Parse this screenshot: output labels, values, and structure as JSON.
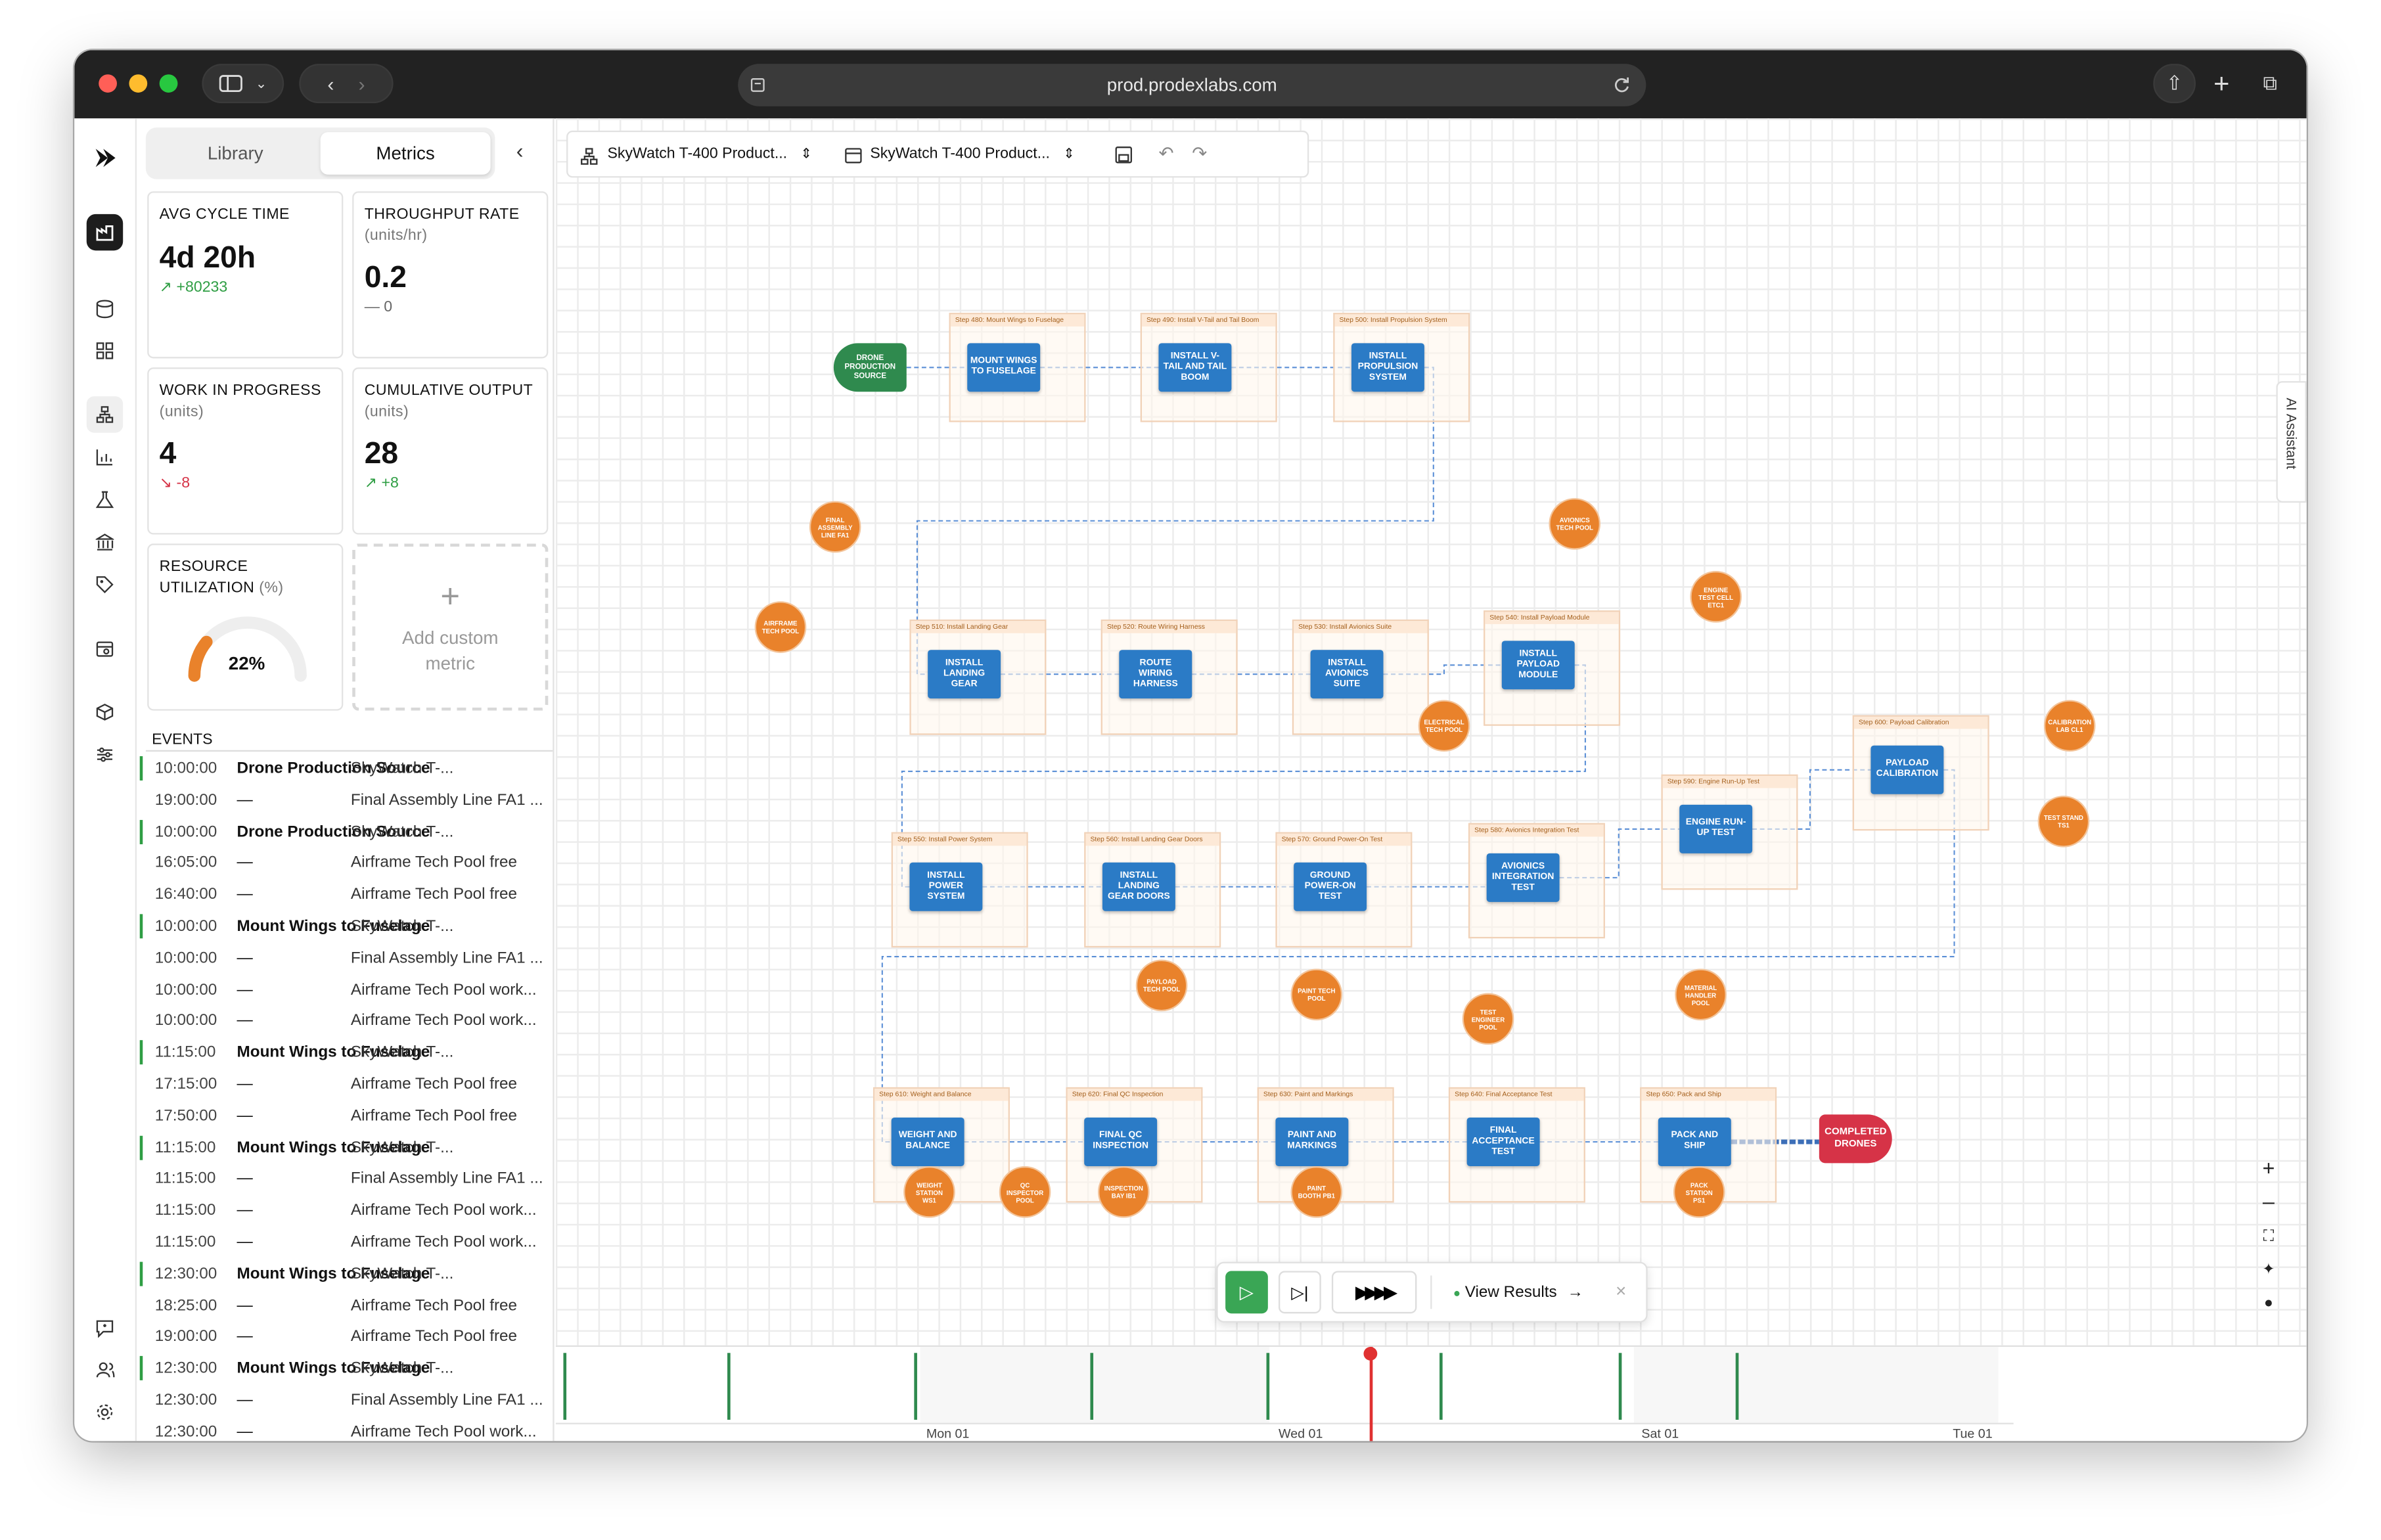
{
  "browser": {
    "url": "prod.prodexlabs.com"
  },
  "panel": {
    "tabs": [
      "Library",
      "Metrics"
    ],
    "metrics": [
      {
        "label": "AVG CYCLE TIME",
        "unit": "",
        "value": "4d 20h",
        "delta": "+80233",
        "trend": "up"
      },
      {
        "label": "THROUGHPUT RATE",
        "unit": "(units/hr)",
        "value": "0.2",
        "delta": "0",
        "trend": "flat"
      },
      {
        "label": "WORK IN PROGRESS",
        "unit": "(units)",
        "value": "4",
        "delta": "-8",
        "trend": "down"
      },
      {
        "label": "CUMULATIVE OUTPUT",
        "unit": "(units)",
        "value": "28",
        "delta": "+8",
        "trend": "up"
      }
    ],
    "utilization": {
      "label": "RESOURCE UTILIZATION",
      "unit": "(%)",
      "value": "22%",
      "fraction": 0.22
    },
    "add_metric": "Add custom metric",
    "events_title": "EVENTS",
    "events": [
      {
        "time": "10:00:00",
        "name": "Drone Production Source",
        "desc": "SkyWatch T-...",
        "bar": true
      },
      {
        "time": "19:00:00",
        "name": "—",
        "desc": "Final Assembly Line FA1 ...",
        "bar": false
      },
      {
        "time": "10:00:00",
        "name": "Drone Production Source",
        "desc": "SkyWatch T-...",
        "bar": true
      },
      {
        "time": "16:05:00",
        "name": "—",
        "desc": "Airframe Tech Pool free",
        "bar": false
      },
      {
        "time": "16:40:00",
        "name": "—",
        "desc": "Airframe Tech Pool free",
        "bar": false
      },
      {
        "time": "10:00:00",
        "name": "Mount Wings to Fuselage",
        "desc": "SkyWatch T-...",
        "bar": true
      },
      {
        "time": "10:00:00",
        "name": "—",
        "desc": "Final Assembly Line FA1 ...",
        "bar": false
      },
      {
        "time": "10:00:00",
        "name": "—",
        "desc": "Airframe Tech Pool work...",
        "bar": false
      },
      {
        "time": "10:00:00",
        "name": "—",
        "desc": "Airframe Tech Pool work...",
        "bar": false
      },
      {
        "time": "11:15:00",
        "name": "Mount Wings to Fuselage",
        "desc": "SkyWatch T-...",
        "bar": true
      },
      {
        "time": "17:15:00",
        "name": "—",
        "desc": "Airframe Tech Pool free",
        "bar": false
      },
      {
        "time": "17:50:00",
        "name": "—",
        "desc": "Airframe Tech Pool free",
        "bar": false
      },
      {
        "time": "11:15:00",
        "name": "Mount Wings to Fuselage",
        "desc": "SkyWatch T-...",
        "bar": true
      },
      {
        "time": "11:15:00",
        "name": "—",
        "desc": "Final Assembly Line FA1 ...",
        "bar": false
      },
      {
        "time": "11:15:00",
        "name": "—",
        "desc": "Airframe Tech Pool work...",
        "bar": false
      },
      {
        "time": "11:15:00",
        "name": "—",
        "desc": "Airframe Tech Pool work...",
        "bar": false
      },
      {
        "time": "12:30:00",
        "name": "Mount Wings to Fuselage",
        "desc": "SkyWatch T-...",
        "bar": true
      },
      {
        "time": "18:25:00",
        "name": "—",
        "desc": "Airframe Tech Pool free",
        "bar": false
      },
      {
        "time": "19:00:00",
        "name": "—",
        "desc": "Airframe Tech Pool free",
        "bar": false
      },
      {
        "time": "12:30:00",
        "name": "Mount Wings to Fuselage",
        "desc": "SkyWatch T-...",
        "bar": true
      },
      {
        "time": "12:30:00",
        "name": "—",
        "desc": "Final Assembly Line FA1 ...",
        "bar": false
      },
      {
        "time": "12:30:00",
        "name": "—",
        "desc": "Airframe Tech Pool work...",
        "bar": false
      }
    ]
  },
  "toolbar": {
    "model": "SkyWatch T-400 Product...",
    "scenario": "SkyWatch T-400 Product..."
  },
  "flow": {
    "source": "DRONE PRODUCTION SOURCE",
    "sink": "COMPLETED DRONES",
    "steps": [
      {
        "header": "Step 480: Mount Wings to Fuselage",
        "label": "MOUNT WINGS TO FUSELAGE"
      },
      {
        "header": "Step 490: Install V-Tail and Tail Boom",
        "label": "INSTALL V-TAIL AND TAIL BOOM"
      },
      {
        "header": "Step 500: Install Propulsion System",
        "label": "INSTALL PROPULSION SYSTEM"
      },
      {
        "header": "Step 510: Install Landing Gear",
        "label": "INSTALL LANDING GEAR"
      },
      {
        "header": "Step 520: Route Wiring Harness",
        "label": "ROUTE WIRING HARNESS"
      },
      {
        "header": "Step 530: Install Avionics Suite",
        "label": "INSTALL AVIONICS SUITE"
      },
      {
        "header": "Step 540: Install Payload Module",
        "label": "INSTALL PAYLOAD MODULE"
      },
      {
        "header": "Step 550: Install Power System",
        "label": "INSTALL POWER SYSTEM"
      },
      {
        "header": "Step 560: Install Landing Gear Doors",
        "label": "INSTALL LANDING GEAR DOORS"
      },
      {
        "header": "Step 570: Ground Power-On Test",
        "label": "GROUND POWER-ON TEST"
      },
      {
        "header": "Step 580: Avionics Integration Test",
        "label": "AVIONICS INTEGRATION TEST"
      },
      {
        "header": "Step 590: Engine Run-Up Test",
        "label": "ENGINE RUN-UP TEST"
      },
      {
        "header": "Step 600: Payload Calibration",
        "label": "PAYLOAD CALIBRATION"
      },
      {
        "header": "Step 610: Weight and Balance",
        "label": "WEIGHT AND BALANCE"
      },
      {
        "header": "Step 620: Final QC Inspection",
        "label": "FINAL QC INSPECTION"
      },
      {
        "header": "Step 630: Paint and Markings",
        "label": "PAINT AND MARKINGS"
      },
      {
        "header": "Step 640: Final Acceptance Test",
        "label": "FINAL ACCEPTANCE TEST"
      },
      {
        "header": "Step 650: Pack and Ship",
        "label": "PACK AND SHIP"
      }
    ],
    "resources": [
      "FINAL ASSEMBLY LINE FA1",
      "AIRFRAME TECH POOL",
      "AVIONICS TECH POOL",
      "ENGINE TEST CELL ETC1",
      "ELECTRICAL TECH POOL",
      "CALIBRATION LAB CL1",
      "TEST STAND TS1",
      "PAYLOAD TECH POOL",
      "PAINT TECH POOL",
      "TEST ENGINEER POOL",
      "MATERIAL HANDLER POOL",
      "WEIGHT STATION WS1",
      "QC INSPECTOR POOL",
      "INSPECTION BAY IB1",
      "PAINT BOOTH PB1",
      "PACK STATION PS1"
    ]
  },
  "playbar": {
    "view_results": "View Results"
  },
  "timeline": {
    "labels": [
      "Mon 01",
      "Wed 01",
      "Sat 01",
      "Tue 01"
    ]
  },
  "ai_assistant": "AI Assistant",
  "colors": {
    "process": "#2b7bc6",
    "resource": "#e9822b",
    "source": "#2f8a4e",
    "sink": "#d63347",
    "accent": "#2f9e44"
  }
}
